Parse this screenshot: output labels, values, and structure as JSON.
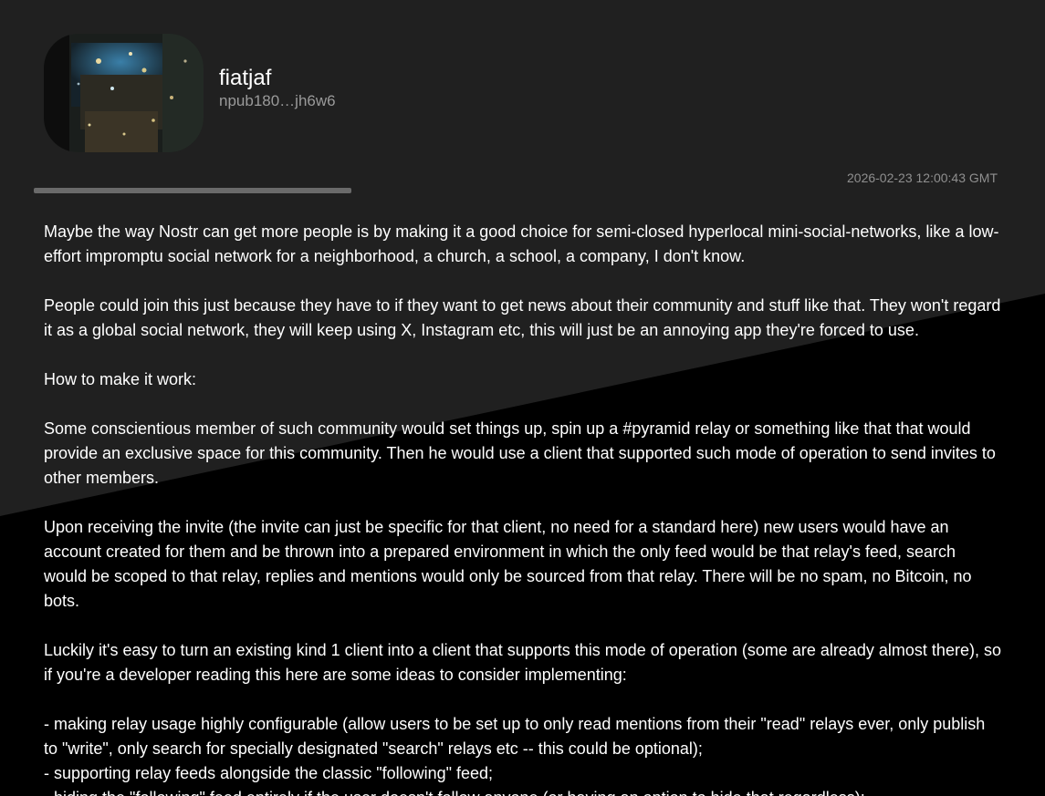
{
  "profile": {
    "name": "fiatjaf",
    "npub": "npub180…jh6w6"
  },
  "note": {
    "timestamp": "2026-02-23 12:00:43 GMT",
    "paragraphs": [
      "Maybe the way Nostr can get more people is by making it a good choice for semi-closed hyperlocal mini-social-networks, like a low-effort impromptu social network for a neighborhood, a church, a school, a company, I don't know.",
      "People could join this just because they have to if they want to get news about their community and stuff like that. They won't regard it as a global social network, they will keep using X, Instagram etc, this will just be an annoying app they're forced to use.",
      "How to make it work:",
      "Some conscientious member of such community would set things up, spin up a #pyramid relay or something like that that would provide an exclusive space for this community. Then he would use a client that supported such mode of operation to send invites to other members.",
      "Upon receiving the invite (the invite can just be specific for that client, no need for a standard here) new users would have an account created for them and be thrown into a prepared environment in which the only feed would be that relay's feed, search would be scoped to that relay, replies and mentions would only be sourced from that relay. There will be no spam, no Bitcoin, no bots.",
      "Luckily it's easy to turn an existing kind 1 client into a client that supports this mode of operation (some are already almost there), so if you're a developer reading this here are some ideas to consider implementing:"
    ],
    "list_items": [
      "- making relay usage highly configurable (allow users to be set up to only read mentions from their \"read\" relays ever, only publish to \"write\", only search for specially designated \"search\" relays etc -- this could be optional);",
      "- supporting relay feeds alongside the classic \"following\" feed;",
      "- hiding the \"following\" feed entirely if the user doesn't follow anyone (or having an option to hide that regardless);"
    ]
  },
  "colors": {
    "background_dark": "#1f1f1f",
    "background_black": "#000000",
    "text": "#ffffff",
    "muted_text": "#9a9a9a",
    "divider": "#6a6a6a"
  }
}
